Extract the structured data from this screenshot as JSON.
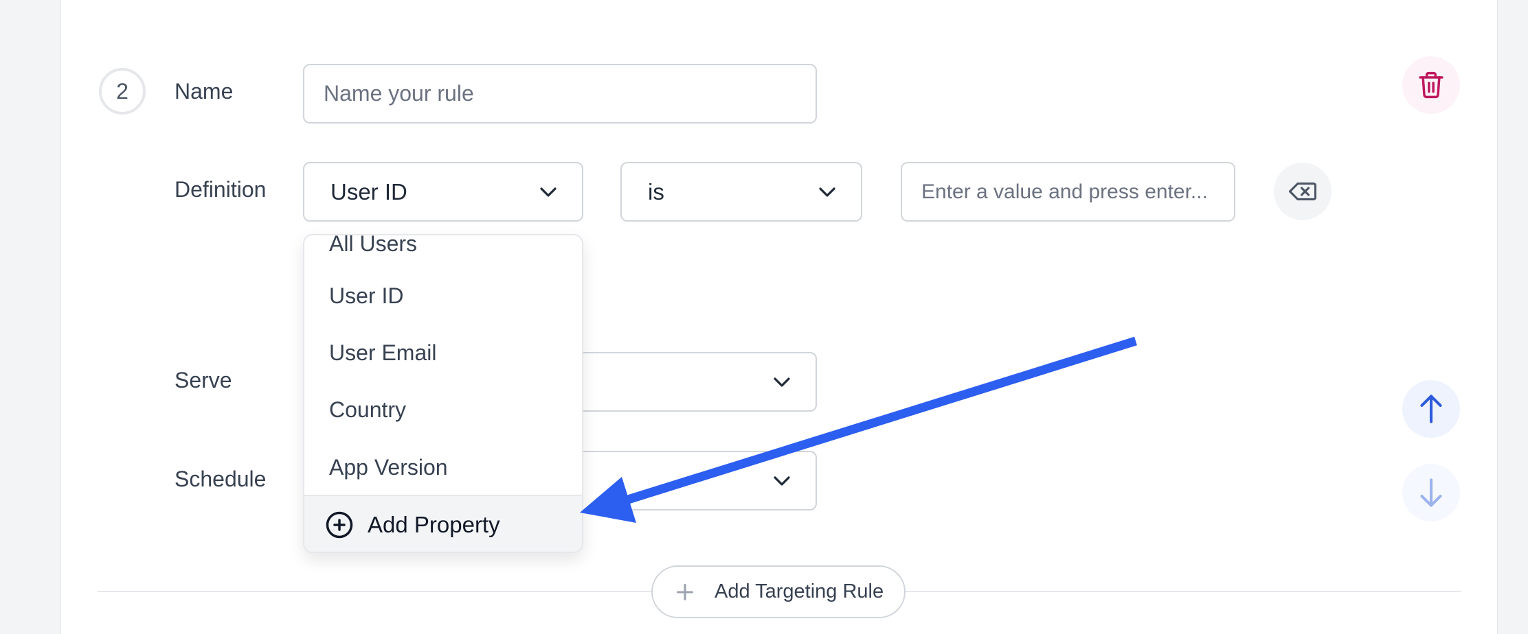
{
  "rule": {
    "number": "2",
    "name_label": "Name",
    "name_placeholder": "Name your rule",
    "name_value": "",
    "definition_label": "Definition",
    "property_selected": "User ID",
    "operator_selected": "is",
    "value_placeholder": "Enter a value and press enter...",
    "serve_label": "Serve",
    "schedule_label": "Schedule"
  },
  "dropdown": {
    "items": [
      "All Users",
      "User ID",
      "User Email",
      "Country",
      "App Version"
    ],
    "add_property_label": "Add Property"
  },
  "footer": {
    "add_targeting_rule_label": "Add Targeting Rule"
  },
  "icons": {
    "delete": "trash-icon",
    "clear": "backspace-icon",
    "move_up": "arrow-up-icon",
    "move_down": "arrow-down-icon",
    "add_property": "plus-circle-icon",
    "add_rule": "plus-icon",
    "select": "chevron-down-icon"
  },
  "colors": {
    "danger": "#be185d",
    "danger_bg": "#fdf2f8",
    "primary": "#2d5bdb",
    "primary_bg": "#eef3fd",
    "annotation_arrow": "#2c5ef0"
  }
}
